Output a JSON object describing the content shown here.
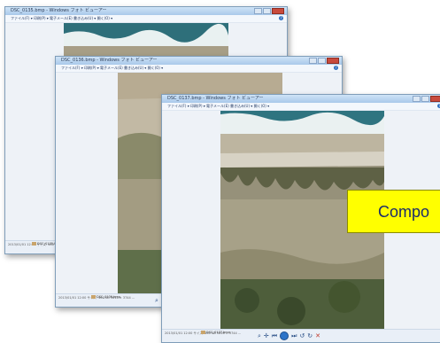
{
  "windows": [
    {
      "title": "DSC_0135.bmp - Windows フォト ビューアー",
      "menus": "ファイル(F) ▾   印刷(P) ▾   電子メール(E)   書き込み(U) ▾   開く(O) ▾",
      "status": "2013/01/01 12:00   サイズ: 460 KB\n5616 × 3744   ...",
      "filename": "DSC_0135.bmp"
    },
    {
      "title": "DSC_0136.bmp - Windows フォト ビューアー",
      "menus": "ファイル(F) ▾   印刷(P) ▾   電子メール(E)   書き込み(U) ▾   開く(O) ▾",
      "status": "2013/01/01 12:00   サイズ: 460 KB\n5616 × 3744   ...",
      "filename": "DSC_0136.bmp"
    },
    {
      "title": "DSC_0137.bmp - Windows フォト ビューアー",
      "menus": "ファイル(F) ▾   印刷(P) ▾   電子メール(E)   書き込み(U) ▾   開く(O) ▾",
      "status": "2013/01/01 12:00   サイズ: 460 KB\n5616 × 3744   ...",
      "filename": "DSC_0137.bmp"
    }
  ],
  "controls": {
    "zoom": "⌕",
    "fit": "✛",
    "prev": "⏮",
    "play": "",
    "next": "⏭",
    "rotate_ccw": "↺",
    "rotate_cw": "↻",
    "delete": "✕"
  },
  "help_icon": "?",
  "callout": {
    "text": "Compo"
  }
}
